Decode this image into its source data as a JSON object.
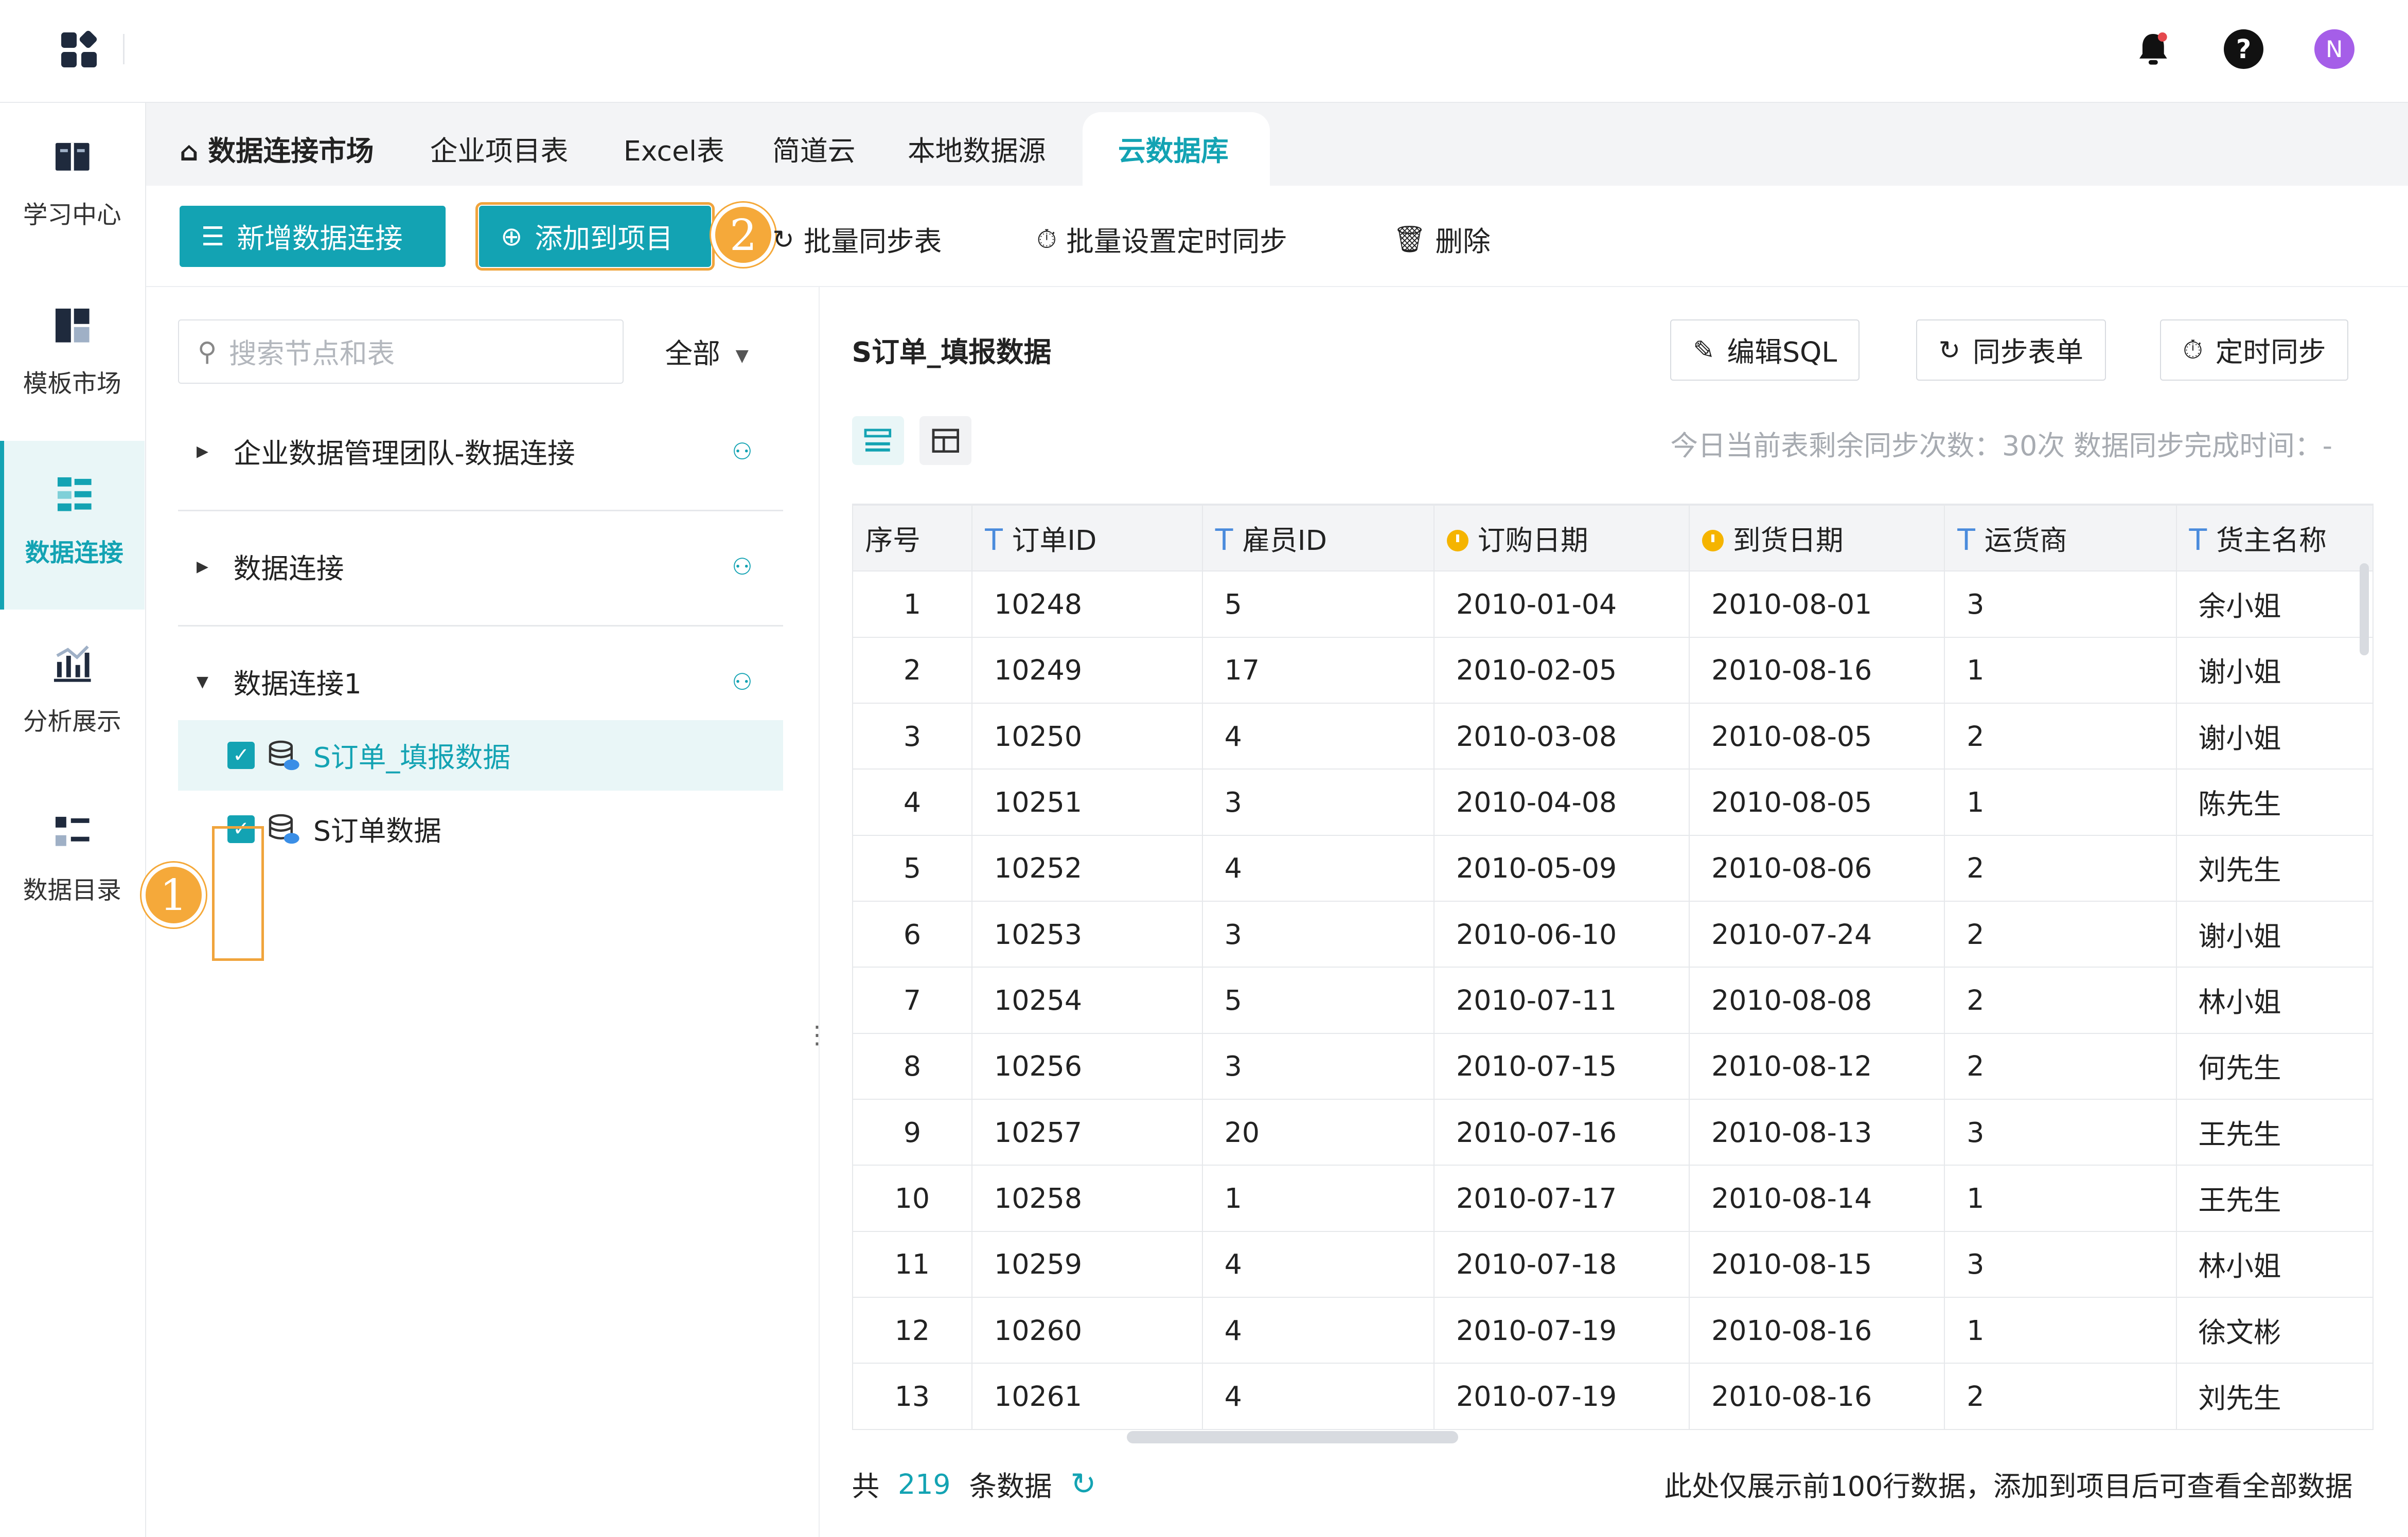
{
  "topbar": {
    "help_glyph": "?",
    "avatar_initial": "N"
  },
  "leftnav": {
    "items": [
      {
        "label": "学习中心",
        "icon": "book-icon"
      },
      {
        "label": "模板市场",
        "icon": "template-icon"
      },
      {
        "label": "数据连接",
        "icon": "data-connection-icon",
        "active": true
      },
      {
        "label": "分析展示",
        "icon": "chart-icon"
      },
      {
        "label": "数据目录",
        "icon": "catalog-icon"
      }
    ]
  },
  "tabs": {
    "home": "数据连接市场",
    "items": [
      "企业项目表",
      "Excel表",
      "简道云",
      "本地数据源",
      "云数据库"
    ],
    "active": "云数据库"
  },
  "toolbar": {
    "new_connection": "新增数据连接",
    "add_to_project": "添加到项目",
    "batch_sync": "批量同步表",
    "batch_schedule": "批量设置定时同步",
    "delete": "删除",
    "badge_1": "1",
    "badge_2": "2"
  },
  "tree": {
    "search_placeholder": "搜索节点和表",
    "filter_value": "全部",
    "nodes": [
      {
        "label": "企业数据管理团队-数据连接",
        "expanded": false
      },
      {
        "label": "数据连接",
        "expanded": false
      },
      {
        "label": "数据连接1",
        "expanded": true
      }
    ],
    "leaves": [
      {
        "label": "S订单_填报数据",
        "checked": true,
        "selected": true
      },
      {
        "label": "S订单数据",
        "checked": true,
        "selected": false
      }
    ]
  },
  "content": {
    "title": "S订单_填报数据",
    "edit_sql": "编辑SQL",
    "sync_form": "同步表单",
    "scheduled_sync": "定时同步",
    "sync_info": "今日当前表剩余同步次数：30次    数据同步完成时间：-",
    "columns": [
      {
        "label": "序号",
        "type": ""
      },
      {
        "label": "订单ID",
        "type": "T"
      },
      {
        "label": "雇员ID",
        "type": "T"
      },
      {
        "label": "订购日期",
        "type": "D"
      },
      {
        "label": "到货日期",
        "type": "D"
      },
      {
        "label": "运货商",
        "type": "T"
      },
      {
        "label": "货主名称",
        "type": "T"
      }
    ],
    "rows": [
      [
        "1",
        "10248",
        "5",
        "2010-01-04",
        "2010-08-01",
        "3",
        "余小姐"
      ],
      [
        "2",
        "10249",
        "17",
        "2010-02-05",
        "2010-08-16",
        "1",
        "谢小姐"
      ],
      [
        "3",
        "10250",
        "4",
        "2010-03-08",
        "2010-08-05",
        "2",
        "谢小姐"
      ],
      [
        "4",
        "10251",
        "3",
        "2010-04-08",
        "2010-08-05",
        "1",
        "陈先生"
      ],
      [
        "5",
        "10252",
        "4",
        "2010-05-09",
        "2010-08-06",
        "2",
        "刘先生"
      ],
      [
        "6",
        "10253",
        "3",
        "2010-06-10",
        "2010-07-24",
        "2",
        "谢小姐"
      ],
      [
        "7",
        "10254",
        "5",
        "2010-07-11",
        "2010-08-08",
        "2",
        "林小姐"
      ],
      [
        "8",
        "10256",
        "3",
        "2010-07-15",
        "2010-08-12",
        "2",
        "何先生"
      ],
      [
        "9",
        "10257",
        "20",
        "2010-07-16",
        "2010-08-13",
        "3",
        "王先生"
      ],
      [
        "10",
        "10258",
        "1",
        "2010-07-17",
        "2010-08-14",
        "1",
        "王先生"
      ],
      [
        "11",
        "10259",
        "4",
        "2010-07-18",
        "2010-08-15",
        "3",
        "林小姐"
      ],
      [
        "12",
        "10260",
        "4",
        "2010-07-19",
        "2010-08-16",
        "1",
        "徐文彬"
      ],
      [
        "13",
        "10261",
        "4",
        "2010-07-19",
        "2010-08-16",
        "2",
        "刘先生"
      ]
    ],
    "footer_prefix": "共",
    "footer_count": "219",
    "footer_suffix": "条数据",
    "footer_note": "此处仅展示前100行数据，添加到项目后可查看全部数据"
  },
  "colors": {
    "accent": "#13a3b3",
    "highlight": "#f0a43c",
    "date_type": "#f5b400",
    "text_type": "#4a8bdc"
  }
}
